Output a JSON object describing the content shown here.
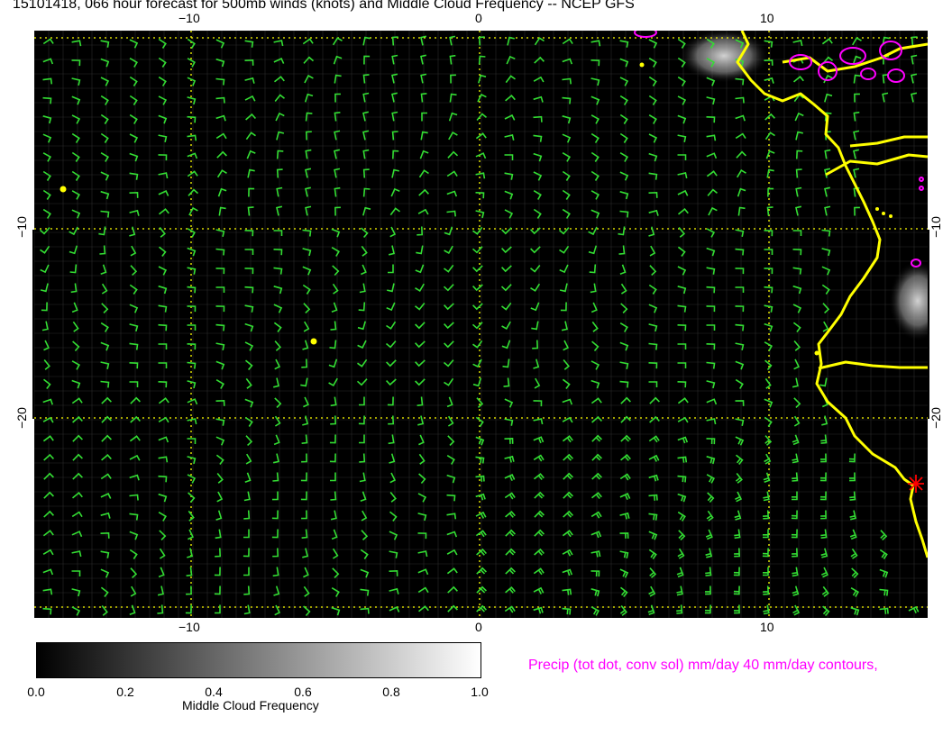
{
  "title": "15101418, 066 hour forecast for 500mb winds (knots) and Middle Cloud Frequency -- NCEP GFS",
  "axes": {
    "top_ticks": [
      "−10",
      "0",
      "10"
    ],
    "bottom_ticks": [
      "−10",
      "0",
      "10"
    ],
    "left_ticks": [
      "−10",
      "−20"
    ],
    "right_ticks": [
      "−10",
      "−20"
    ]
  },
  "colorbar": {
    "label": "Middle Cloud Frequency",
    "ticks": [
      "0.0",
      "0.2",
      "0.4",
      "0.6",
      "0.8",
      "1.0"
    ],
    "colors": {
      "low": "#000000",
      "high": "#ffffff"
    }
  },
  "precip_note": "Precip (tot dot, conv sol) mm/day 40 mm/day contours,",
  "colors": {
    "wind_barbs": "#33dd33",
    "coastline": "#ffff00",
    "precip_contours": "#ff00ff",
    "grid_dotted": "#ffff00",
    "station_marker": "#ff0000"
  },
  "icons": {
    "station_marker": "red-asterisk-icon"
  }
}
